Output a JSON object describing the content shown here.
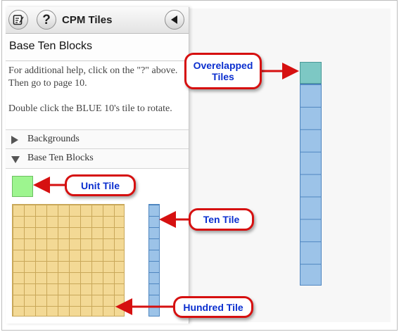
{
  "header": {
    "app_title": "CPM Tiles",
    "edit_icon": "edit-notes-icon",
    "help_glyph": "?",
    "collapse_icon": "left-arrow-icon"
  },
  "panel": {
    "section_title": "Base Ten Blocks",
    "help_text": [
      "For additional help, click on the \"?\" above. Then go to page 10.",
      "Double click the BLUE 10's tile to rotate."
    ],
    "rows": [
      {
        "label": "Backgrounds",
        "state": "collapsed"
      },
      {
        "label": "Base Ten Blocks",
        "state": "expanded"
      }
    ]
  },
  "tiles": {
    "unit_color": "#9df58f",
    "hundred_color": "#f3d995",
    "ten_color": "#9cc3e8",
    "overlap_color": "#7dc8c4"
  },
  "callouts": {
    "overlapped": "Overelapped Tiles",
    "unit": "Unit Tile",
    "ten": "Ten Tile",
    "hundred": "Hundred Tile"
  },
  "colors": {
    "callout_border": "#d61010",
    "callout_text": "#0b2fcf"
  }
}
